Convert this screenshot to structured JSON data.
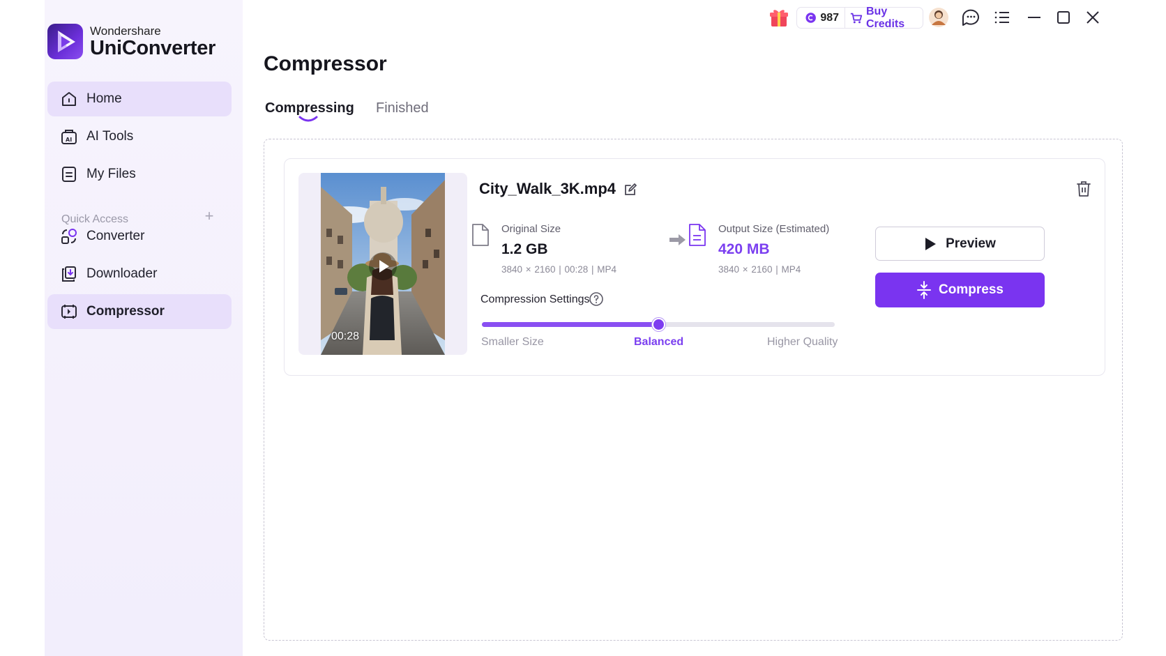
{
  "app": {
    "brand_small": "Wondershare",
    "brand_name": "UniConverter"
  },
  "sidebar": {
    "items": [
      {
        "label": "Home",
        "icon": "home-icon"
      },
      {
        "label": "AI Tools",
        "icon": "ai-tools-icon"
      },
      {
        "label": "My Files",
        "icon": "my-files-icon"
      }
    ],
    "quick_access_label": "Quick Access",
    "quick_items": [
      {
        "label": "Converter",
        "icon": "converter-icon"
      },
      {
        "label": "Downloader",
        "icon": "downloader-icon"
      },
      {
        "label": "Compressor",
        "icon": "compressor-icon",
        "active": true
      }
    ]
  },
  "topbar": {
    "credits_count": "987",
    "buy_credits_label": "Buy Credits",
    "accent_color": "#7a34f0"
  },
  "page": {
    "title": "Compressor",
    "tabs": [
      {
        "label": "Compressing",
        "active": true
      },
      {
        "label": "Finished",
        "active": false
      }
    ]
  },
  "file": {
    "name": "City_Walk_3K.mp4",
    "duration": "00:28",
    "original": {
      "label": "Original Size",
      "size": "1.2 GB",
      "meta": "3840 × 2160  |  00:28  |  MP4"
    },
    "output": {
      "label": "Output Size (Estimated)",
      "size": "420 MB",
      "meta": "3840 × 2160  |  MP4"
    }
  },
  "compression": {
    "label": "Compression Settings",
    "level": 0.5,
    "ticks": [
      "Smaller Size",
      "Balanced",
      "Higher Quality"
    ],
    "selected": "Balanced"
  },
  "buttons": {
    "preview": "Preview",
    "compress": "Compress"
  }
}
